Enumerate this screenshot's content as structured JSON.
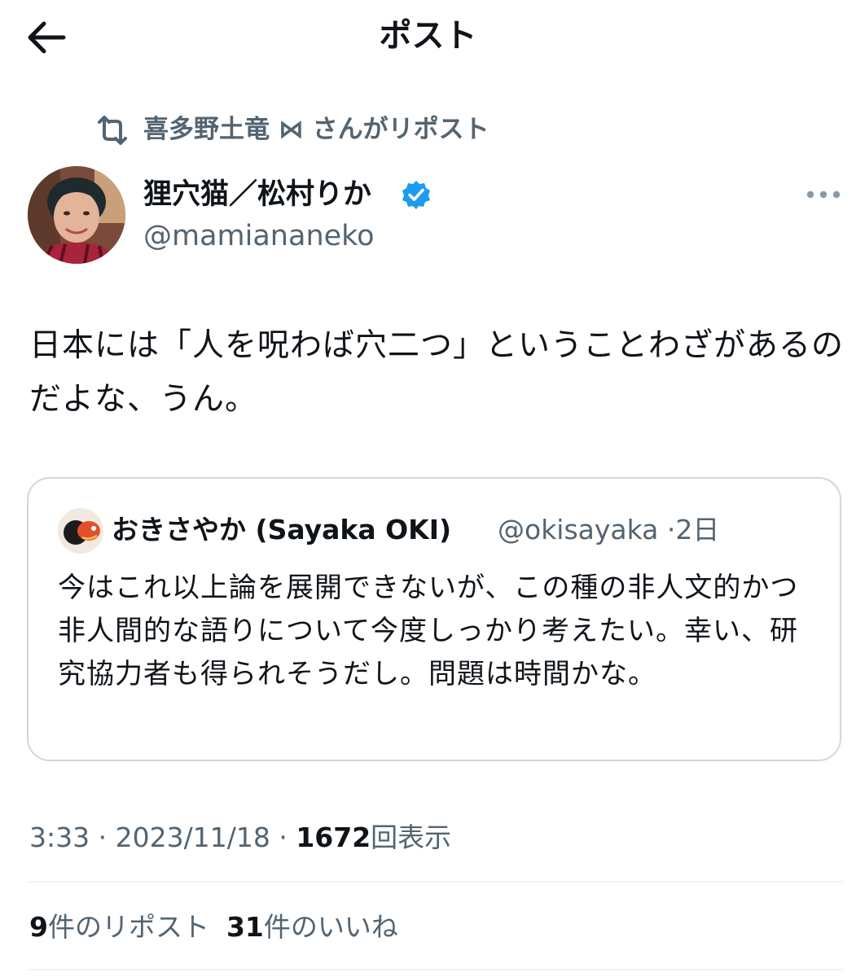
{
  "header": {
    "back_icon": "arrow-left-icon",
    "title": "ポスト"
  },
  "repost": {
    "icon": "repost-icon",
    "text": "喜多野土竜 ⋈ さんがリポスト"
  },
  "author": {
    "name": "狸穴猫／松村りか",
    "handle": "@mamiananeko",
    "verified_icon": "verified-badge-icon",
    "verified_color": "#1d9bf0",
    "more_icon": "more-dots-icon"
  },
  "post": {
    "text": "日本には「人を呪わば穴二つ」ということわざがあるのだよな、うん。"
  },
  "quote": {
    "name": "おきさやか (Sayaka OKI)",
    "handle": "@okisayaka",
    "separator": "·",
    "age": "2日",
    "text": "今はこれ以上論を展開できないが、この種の非人文的かつ非人間的な語りについて今度しっかり考えたい。幸い、研究協力者も得られそうだし。問題は時間かな。"
  },
  "meta": {
    "time": "3:33",
    "separator": "·",
    "date": "2023/11/18",
    "views": "1672",
    "views_label": "回表示"
  },
  "stats": {
    "reposts_count": "9",
    "reposts_label": "件のリポスト",
    "likes_count": "31",
    "likes_label": "件のいいね"
  },
  "colors": {
    "text": "#0f1419",
    "secondary": "#536471",
    "border": "#cfd9de",
    "accent": "#1d9bf0"
  }
}
